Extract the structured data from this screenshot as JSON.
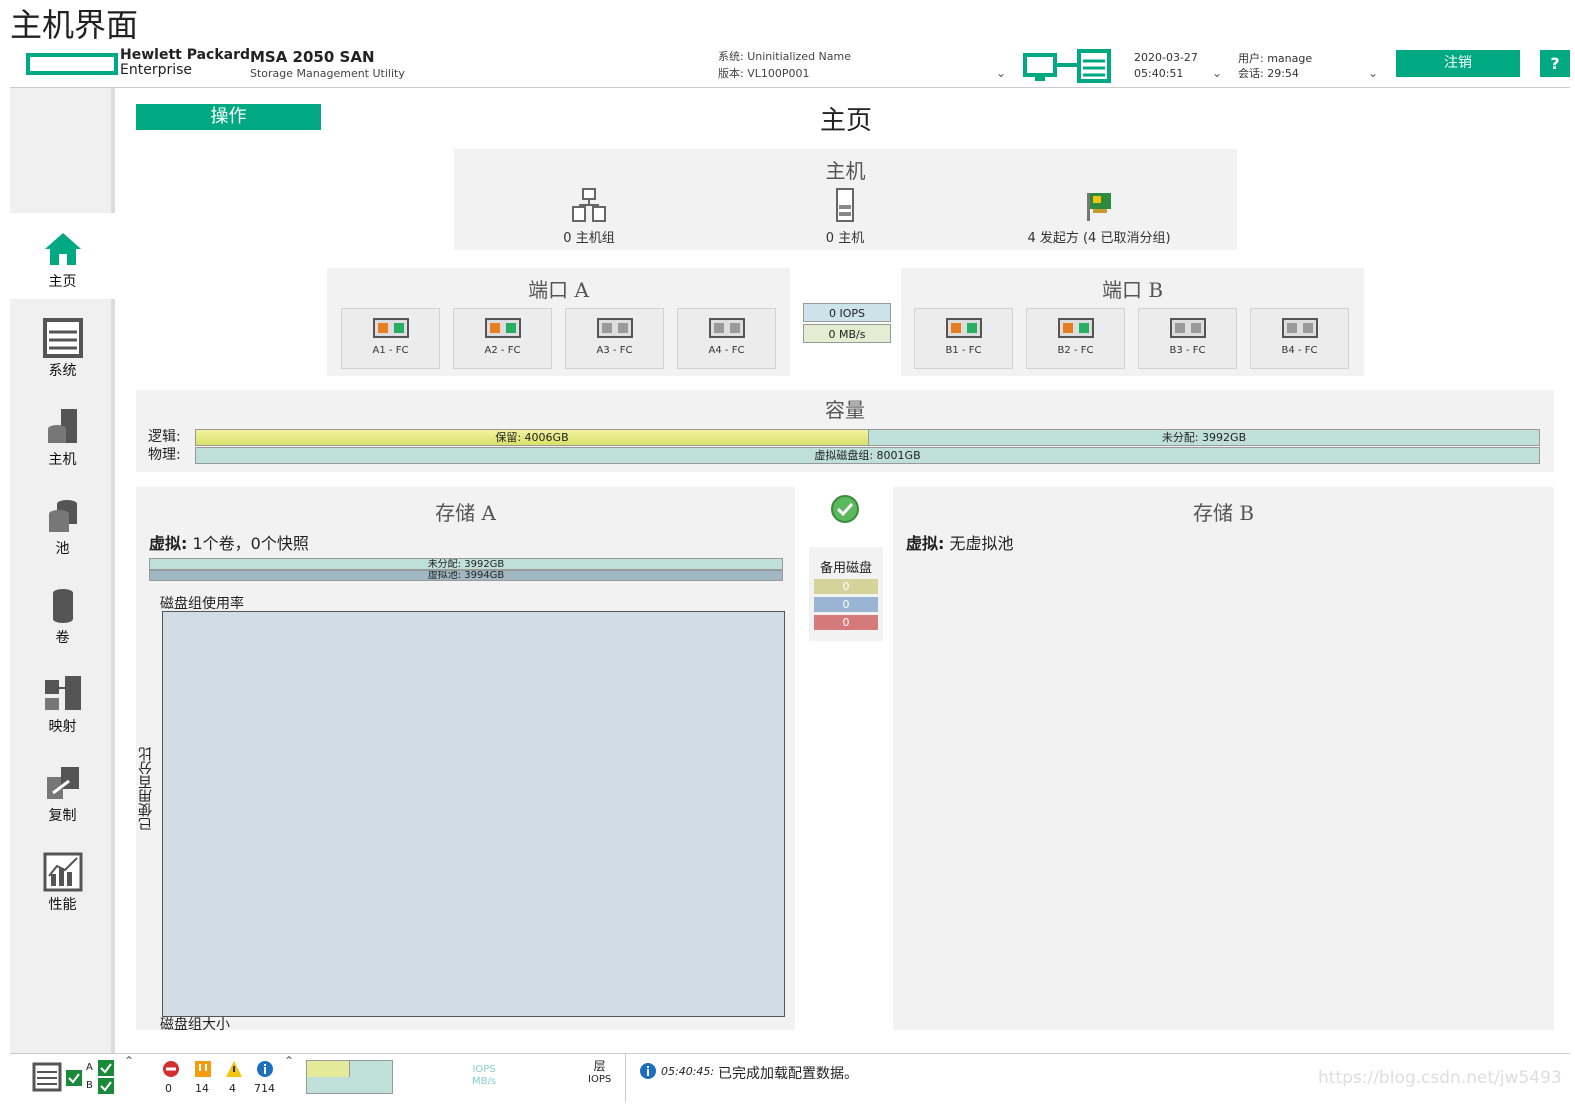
{
  "page_title": "主机界面",
  "header": {
    "brand_line1": "Hewlett Packard",
    "brand_line2": "Enterprise",
    "product": "MSA 2050 SAN",
    "product_sub": "Storage Management Utility",
    "system_name": "系统: Uninitialized Name",
    "version": "版本: VL100P001",
    "date": "2020-03-27",
    "time": "05:40:51",
    "user": "用户: manage",
    "session": "会话: 29:54",
    "logout_label": "注销",
    "help_label": "?"
  },
  "sidebar": {
    "items": [
      {
        "label": "主页",
        "icon": "home-icon"
      },
      {
        "label": "系统",
        "icon": "system-icon"
      },
      {
        "label": "主机",
        "icon": "host-icon"
      },
      {
        "label": "池",
        "icon": "pool-icon"
      },
      {
        "label": "卷",
        "icon": "volume-icon"
      },
      {
        "label": "映射",
        "icon": "mapping-icon"
      },
      {
        "label": "复制",
        "icon": "replication-icon"
      },
      {
        "label": "性能",
        "icon": "performance-icon"
      }
    ]
  },
  "main": {
    "ops_label": "操作",
    "title": "主页",
    "hosts": {
      "title": "主机",
      "host_groups": "0 主机组",
      "hosts": "0 主机",
      "initiators": "4 发起方 (4 已取消分组)"
    },
    "port_a": {
      "title": "端口 A",
      "ports": [
        "A1 - FC",
        "A2 - FC",
        "A3 - FC",
        "A4 - FC"
      ]
    },
    "port_b": {
      "title": "端口 B",
      "ports": [
        "B1 - FC",
        "B2 - FC",
        "B3 - FC",
        "B4 - FC"
      ]
    },
    "io": {
      "iops": "0 IOPS",
      "mbs": "0 MB/s"
    },
    "capacity": {
      "title": "容量",
      "logical_label": "逻辑:",
      "physical_label": "物理:",
      "reserved": "保留: 4006GB",
      "reserved_fraction": 0.501,
      "unallocated": "未分配: 3992GB",
      "vdisk_group": "虚拟磁盘组: 8001GB"
    },
    "storage_a": {
      "title": "存储 A",
      "virtual_label": "虚拟:",
      "virtual_value": "1个卷，0个快照",
      "bar_unalloc": "未分配: 3992GB",
      "bar_pool": "虚拟池: 3994GB",
      "chart_title": "磁盘组使用率",
      "y_label": "已使用百分比",
      "x_label": "磁盘组大小"
    },
    "spare": {
      "title": "备用磁盘",
      "values": [
        "0",
        "0",
        "0"
      ]
    },
    "storage_b": {
      "title": "存储 B",
      "virtual_label": "虚拟:",
      "virtual_value": "无虚拟池"
    }
  },
  "statusbar": {
    "ctrl_a": "A",
    "ctrl_b": "B",
    "counts": [
      "0",
      "14",
      "4",
      "714"
    ],
    "iops_label": "IOPS",
    "mbs_label": "MB/s",
    "tier_label": "层",
    "tier_iops": "IOPS",
    "msg_time": "05:40:45:",
    "message": "已完成加载配置数据。"
  },
  "watermark": "https://blog.csdn.net/jw5493"
}
